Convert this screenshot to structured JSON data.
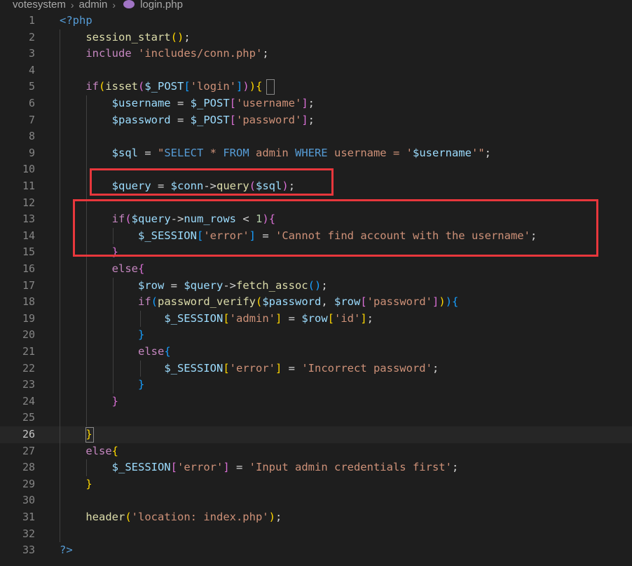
{
  "breadcrumb": {
    "items": [
      "votesystem",
      "admin",
      "login.php"
    ],
    "file_icon": "php-elephant-icon"
  },
  "editor": {
    "active_line": 26,
    "lines": [
      {
        "n": "1",
        "tokens": [
          [
            "<?php",
            "t-tag"
          ]
        ]
      },
      {
        "n": "2",
        "tokens": [
          [
            "    ",
            ""
          ],
          [
            "session_start",
            "t-fn"
          ],
          [
            "()",
            "t-b1"
          ],
          [
            ";",
            "t-op"
          ]
        ]
      },
      {
        "n": "3",
        "tokens": [
          [
            "    ",
            ""
          ],
          [
            "include",
            "t-kw"
          ],
          [
            " ",
            ""
          ],
          [
            "'includes/conn.php'",
            "t-str"
          ],
          [
            ";",
            "t-op"
          ]
        ]
      },
      {
        "n": "4",
        "tokens": []
      },
      {
        "n": "5",
        "tokens": [
          [
            "    ",
            ""
          ],
          [
            "if",
            "t-kw"
          ],
          [
            "(",
            "t-b1"
          ],
          [
            "isset",
            "t-fn"
          ],
          [
            "(",
            "t-b2"
          ],
          [
            "$_POST",
            "t-var"
          ],
          [
            "[",
            "t-b3"
          ],
          [
            "'login'",
            "t-str"
          ],
          [
            "]",
            "t-b3"
          ],
          [
            ")",
            "t-b2"
          ],
          [
            ")",
            "t-b1"
          ],
          [
            "{",
            "t-b1"
          ]
        ]
      },
      {
        "n": "6",
        "tokens": [
          [
            "        ",
            ""
          ],
          [
            "$username",
            "t-var"
          ],
          [
            " = ",
            "t-op"
          ],
          [
            "$_POST",
            "t-var"
          ],
          [
            "[",
            "t-b2"
          ],
          [
            "'username'",
            "t-str"
          ],
          [
            "]",
            "t-b2"
          ],
          [
            ";",
            "t-op"
          ]
        ]
      },
      {
        "n": "7",
        "tokens": [
          [
            "        ",
            ""
          ],
          [
            "$password",
            "t-var"
          ],
          [
            " = ",
            "t-op"
          ],
          [
            "$_POST",
            "t-var"
          ],
          [
            "[",
            "t-b2"
          ],
          [
            "'password'",
            "t-str"
          ],
          [
            "]",
            "t-b2"
          ],
          [
            ";",
            "t-op"
          ]
        ]
      },
      {
        "n": "8",
        "tokens": []
      },
      {
        "n": "9",
        "tokens": [
          [
            "        ",
            ""
          ],
          [
            "$sql",
            "t-var"
          ],
          [
            " = ",
            "t-op"
          ],
          [
            "\"",
            "t-str"
          ],
          [
            "SELECT",
            "t-const"
          ],
          [
            " * ",
            "t-str"
          ],
          [
            "FROM",
            "t-const"
          ],
          [
            " admin ",
            "t-str"
          ],
          [
            "WHERE",
            "t-const"
          ],
          [
            " username = '",
            "t-str"
          ],
          [
            "$username",
            "t-var"
          ],
          [
            "'\"",
            "t-str"
          ],
          [
            ";",
            "t-op"
          ]
        ]
      },
      {
        "n": "10",
        "tokens": []
      },
      {
        "n": "11",
        "tokens": [
          [
            "        ",
            ""
          ],
          [
            "$query",
            "t-var"
          ],
          [
            " = ",
            "t-op"
          ],
          [
            "$conn",
            "t-var"
          ],
          [
            "->",
            "t-op"
          ],
          [
            "query",
            "t-fn"
          ],
          [
            "(",
            "t-b2"
          ],
          [
            "$sql",
            "t-var"
          ],
          [
            ")",
            "t-b2"
          ],
          [
            ";",
            "t-op"
          ]
        ]
      },
      {
        "n": "12",
        "tokens": []
      },
      {
        "n": "13",
        "tokens": [
          [
            "        ",
            ""
          ],
          [
            "if",
            "t-kw"
          ],
          [
            "(",
            "t-b2"
          ],
          [
            "$query",
            "t-var"
          ],
          [
            "->",
            "t-op"
          ],
          [
            "num_rows",
            "t-var"
          ],
          [
            " < ",
            "t-op"
          ],
          [
            "1",
            "t-num"
          ],
          [
            ")",
            "t-b2"
          ],
          [
            "{",
            "t-b2"
          ]
        ]
      },
      {
        "n": "14",
        "tokens": [
          [
            "            ",
            ""
          ],
          [
            "$_SESSION",
            "t-var"
          ],
          [
            "[",
            "t-b3"
          ],
          [
            "'error'",
            "t-str"
          ],
          [
            "]",
            "t-b3"
          ],
          [
            " = ",
            "t-op"
          ],
          [
            "'Cannot find account with the username'",
            "t-str"
          ],
          [
            ";",
            "t-op"
          ]
        ]
      },
      {
        "n": "15",
        "tokens": [
          [
            "        ",
            ""
          ],
          [
            "}",
            "t-b2"
          ]
        ]
      },
      {
        "n": "16",
        "tokens": [
          [
            "        ",
            ""
          ],
          [
            "else",
            "t-kw"
          ],
          [
            "{",
            "t-b2"
          ]
        ]
      },
      {
        "n": "17",
        "tokens": [
          [
            "            ",
            ""
          ],
          [
            "$row",
            "t-var"
          ],
          [
            " = ",
            "t-op"
          ],
          [
            "$query",
            "t-var"
          ],
          [
            "->",
            "t-op"
          ],
          [
            "fetch_assoc",
            "t-fn"
          ],
          [
            "()",
            "t-b3"
          ],
          [
            ";",
            "t-op"
          ]
        ]
      },
      {
        "n": "18",
        "tokens": [
          [
            "            ",
            ""
          ],
          [
            "if",
            "t-kw"
          ],
          [
            "(",
            "t-b3"
          ],
          [
            "password_verify",
            "t-fn"
          ],
          [
            "(",
            "t-b1"
          ],
          [
            "$password",
            "t-var"
          ],
          [
            ", ",
            "t-op"
          ],
          [
            "$row",
            "t-var"
          ],
          [
            "[",
            "t-b2"
          ],
          [
            "'password'",
            "t-str"
          ],
          [
            "]",
            "t-b2"
          ],
          [
            ")",
            "t-b1"
          ],
          [
            ")",
            "t-b3"
          ],
          [
            "{",
            "t-b3"
          ]
        ]
      },
      {
        "n": "19",
        "tokens": [
          [
            "                ",
            ""
          ],
          [
            "$_SESSION",
            "t-var"
          ],
          [
            "[",
            "t-b1"
          ],
          [
            "'admin'",
            "t-str"
          ],
          [
            "]",
            "t-b1"
          ],
          [
            " = ",
            "t-op"
          ],
          [
            "$row",
            "t-var"
          ],
          [
            "[",
            "t-b1"
          ],
          [
            "'id'",
            "t-str"
          ],
          [
            "]",
            "t-b1"
          ],
          [
            ";",
            "t-op"
          ]
        ]
      },
      {
        "n": "20",
        "tokens": [
          [
            "            ",
            ""
          ],
          [
            "}",
            "t-b3"
          ]
        ]
      },
      {
        "n": "21",
        "tokens": [
          [
            "            ",
            ""
          ],
          [
            "else",
            "t-kw"
          ],
          [
            "{",
            "t-b3"
          ]
        ]
      },
      {
        "n": "22",
        "tokens": [
          [
            "                ",
            ""
          ],
          [
            "$_SESSION",
            "t-var"
          ],
          [
            "[",
            "t-b1"
          ],
          [
            "'error'",
            "t-str"
          ],
          [
            "]",
            "t-b1"
          ],
          [
            " = ",
            "t-op"
          ],
          [
            "'Incorrect password'",
            "t-str"
          ],
          [
            ";",
            "t-op"
          ]
        ]
      },
      {
        "n": "23",
        "tokens": [
          [
            "            ",
            ""
          ],
          [
            "}",
            "t-b3"
          ]
        ]
      },
      {
        "n": "24",
        "tokens": [
          [
            "        ",
            ""
          ],
          [
            "}",
            "t-b2"
          ]
        ]
      },
      {
        "n": "25",
        "tokens": []
      },
      {
        "n": "26",
        "tokens": [
          [
            "    ",
            ""
          ],
          [
            "}",
            "t-b1"
          ]
        ]
      },
      {
        "n": "27",
        "tokens": [
          [
            "    ",
            ""
          ],
          [
            "else",
            "t-kw"
          ],
          [
            "{",
            "t-b1"
          ]
        ]
      },
      {
        "n": "28",
        "tokens": [
          [
            "        ",
            ""
          ],
          [
            "$_SESSION",
            "t-var"
          ],
          [
            "[",
            "t-b2"
          ],
          [
            "'error'",
            "t-str"
          ],
          [
            "]",
            "t-b2"
          ],
          [
            " = ",
            "t-op"
          ],
          [
            "'Input admin credentials first'",
            "t-str"
          ],
          [
            ";",
            "t-op"
          ]
        ]
      },
      {
        "n": "29",
        "tokens": [
          [
            "    ",
            ""
          ],
          [
            "}",
            "t-b1"
          ]
        ]
      },
      {
        "n": "30",
        "tokens": []
      },
      {
        "n": "31",
        "tokens": [
          [
            "    ",
            ""
          ],
          [
            "header",
            "t-fn"
          ],
          [
            "(",
            "t-b1"
          ],
          [
            "'location: index.php'",
            "t-str"
          ],
          [
            ")",
            "t-b1"
          ],
          [
            ";",
            "t-op"
          ]
        ]
      },
      {
        "n": "32",
        "tokens": []
      },
      {
        "n": "33",
        "tokens": [
          [
            "?>",
            "t-tag"
          ]
        ]
      }
    ]
  },
  "annotations": {
    "color": "#e8373c"
  }
}
